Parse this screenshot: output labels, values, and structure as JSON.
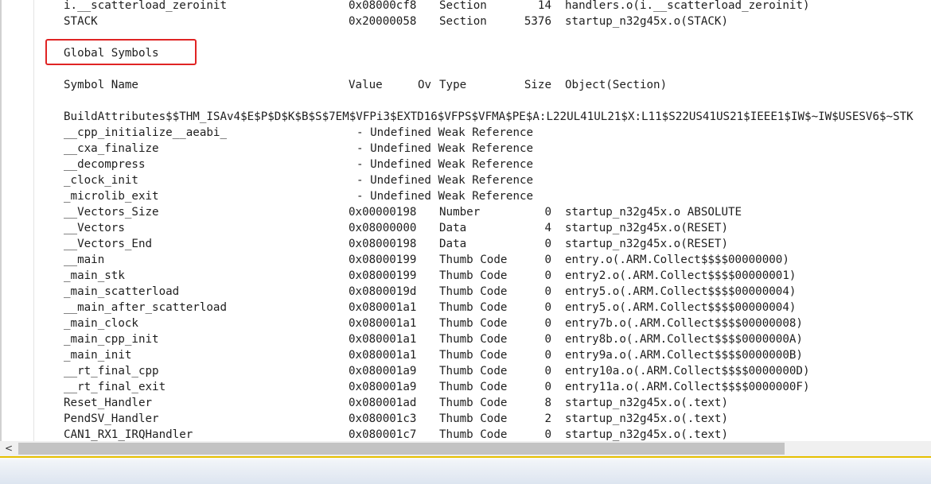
{
  "lines": [
    {
      "name": "i.__scatterload_zeroinit",
      "value": "0x08000cf8",
      "type": "Section",
      "size": "14",
      "object": "handlers.o(i.__scatterload_zeroinit)"
    },
    {
      "name": "STACK",
      "value": "0x20000058",
      "type": "Section",
      "size": "5376",
      "object": "startup_n32g45x.o(STACK)"
    }
  ],
  "section_heading": "Global Symbols",
  "headers": {
    "name": "Symbol Name",
    "value": "Value",
    "ov": "Ov",
    "type": "Type",
    "size": "Size",
    "object": "Object(Section)"
  },
  "build_attributes": "BuildAttributes$$THM_ISAv4$E$P$D$K$B$S$7EM$VFPi3$EXTD16$VFPS$VFMA$PE$A:L22UL41UL21$X:L11$S22US41US21$IEEE1$IW$~IW$USESV6$~STK",
  "undefined_symbols": [
    {
      "name": "__cpp_initialize__aeabi_",
      "text": "- Undefined Weak Reference"
    },
    {
      "name": "__cxa_finalize",
      "text": "- Undefined Weak Reference"
    },
    {
      "name": "__decompress",
      "text": "- Undefined Weak Reference"
    },
    {
      "name": "_clock_init",
      "text": "- Undefined Weak Reference"
    },
    {
      "name": "_microlib_exit",
      "text": "- Undefined Weak Reference"
    }
  ],
  "symbols": [
    {
      "name": "__Vectors_Size",
      "value": "0x00000198",
      "type": "Number",
      "size": "0",
      "object": "startup_n32g45x.o ABSOLUTE"
    },
    {
      "name": "__Vectors",
      "value": "0x08000000",
      "type": "Data",
      "size": "4",
      "object": "startup_n32g45x.o(RESET)"
    },
    {
      "name": "__Vectors_End",
      "value": "0x08000198",
      "type": "Data",
      "size": "0",
      "object": "startup_n32g45x.o(RESET)"
    },
    {
      "name": "__main",
      "value": "0x08000199",
      "type": "Thumb Code",
      "size": "0",
      "object": "entry.o(.ARM.Collect$$$$00000000)"
    },
    {
      "name": "_main_stk",
      "value": "0x08000199",
      "type": "Thumb Code",
      "size": "0",
      "object": "entry2.o(.ARM.Collect$$$$00000001)"
    },
    {
      "name": "_main_scatterload",
      "value": "0x0800019d",
      "type": "Thumb Code",
      "size": "0",
      "object": "entry5.o(.ARM.Collect$$$$00000004)"
    },
    {
      "name": "__main_after_scatterload",
      "value": "0x080001a1",
      "type": "Thumb Code",
      "size": "0",
      "object": "entry5.o(.ARM.Collect$$$$00000004)"
    },
    {
      "name": "_main_clock",
      "value": "0x080001a1",
      "type": "Thumb Code",
      "size": "0",
      "object": "entry7b.o(.ARM.Collect$$$$00000008)"
    },
    {
      "name": "_main_cpp_init",
      "value": "0x080001a1",
      "type": "Thumb Code",
      "size": "0",
      "object": "entry8b.o(.ARM.Collect$$$$0000000A)"
    },
    {
      "name": "_main_init",
      "value": "0x080001a1",
      "type": "Thumb Code",
      "size": "0",
      "object": "entry9a.o(.ARM.Collect$$$$0000000B)"
    },
    {
      "name": "__rt_final_cpp",
      "value": "0x080001a9",
      "type": "Thumb Code",
      "size": "0",
      "object": "entry10a.o(.ARM.Collect$$$$0000000D)"
    },
    {
      "name": "__rt_final_exit",
      "value": "0x080001a9",
      "type": "Thumb Code",
      "size": "0",
      "object": "entry11a.o(.ARM.Collect$$$$0000000F)"
    },
    {
      "name": "Reset_Handler",
      "value": "0x080001ad",
      "type": "Thumb Code",
      "size": "8",
      "object": "startup_n32g45x.o(.text)"
    },
    {
      "name": "PendSV_Handler",
      "value": "0x080001c3",
      "type": "Thumb Code",
      "size": "2",
      "object": "startup_n32g45x.o(.text)"
    },
    {
      "name": "CAN1_RX1_IRQHandler",
      "value": "0x080001c7",
      "type": "Thumb Code",
      "size": "0",
      "object": "startup_n32g45x.o(.text)"
    }
  ],
  "scrollbar": {
    "left_arrow": "<"
  },
  "colors": {
    "highlight_box": "#e02424",
    "divider": "#e6c000",
    "text": "#1e1e1e"
  }
}
